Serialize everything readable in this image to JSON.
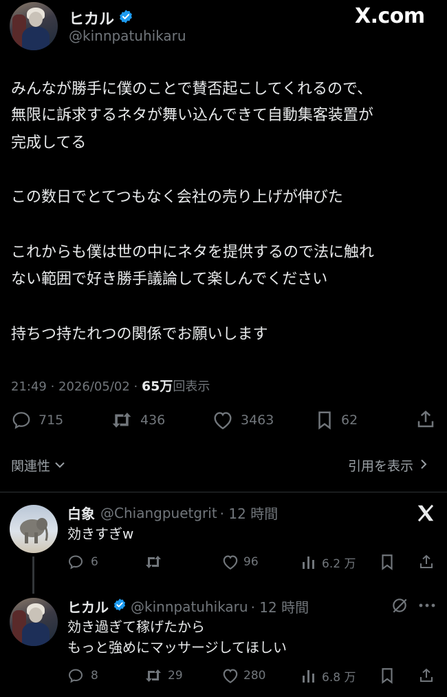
{
  "brand": {
    "logo": "X.com"
  },
  "tweet": {
    "author_name": "ヒカル",
    "author_handle": "@kinnpatuhikaru",
    "lines": [
      "みんなが勝手に僕のことで賛否起こしてくれるので、",
      "無限に訴求するネタが舞い込んできて自動集客装置が",
      "完成してる",
      "この数日でとてつもなく会社の売り上げが伸びた",
      "これからも僕は世の中にネタを提供するので法に触れ",
      "ない範囲で好き勝手議論して楽しんでください",
      "持ちつ持たれつの関係でお願いします"
    ],
    "time": "21:49 · 2026/05/02 · ",
    "views_count": "65万",
    "views_label": "回表示",
    "replies": "715",
    "retweets": "436",
    "likes": "3463",
    "bookmarks": "62"
  },
  "sort": {
    "label": "関連性",
    "quotes_label": "引用を表示"
  },
  "reply1": {
    "name": "白象",
    "handle": "@Chiangpuetgrit",
    "time": "· 12 時間",
    "text": "効きすぎw",
    "replies": "6",
    "likes": "96",
    "views": "6.2 万"
  },
  "reply2": {
    "name": "ヒカル",
    "handle": "@kinnpatuhikaru",
    "time": "· 12 時間",
    "lines": [
      "効き過ぎて稼げたから",
      "もっと強めにマッサージしてほしい"
    ],
    "replies": "8",
    "retweets": "29",
    "likes": "280",
    "views": "6.8 万"
  },
  "colors": {
    "verified": "#1d9bf0",
    "background": "#000000",
    "muted": "#71767b",
    "text": "#e7e9ea"
  }
}
